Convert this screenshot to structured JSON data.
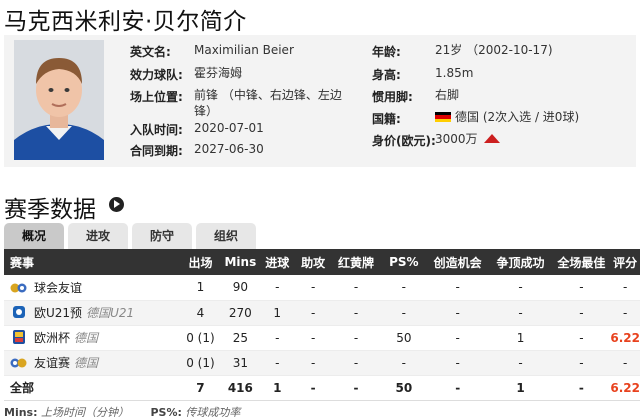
{
  "page": {
    "title": "马克西米利安·贝尔简介"
  },
  "profile": {
    "left": [
      {
        "label": "英文名:",
        "value": "Maximilian Beier"
      },
      {
        "label": "效力球队:",
        "value": "霍芬海姆"
      },
      {
        "label": "场上位置:",
        "value": "前锋 （中锋、右边锋、左边锋）"
      },
      {
        "label": "入队时间:",
        "value": "2020-07-01"
      },
      {
        "label": "合同到期:",
        "value": "2027-06-30"
      }
    ],
    "right": [
      {
        "label": "年龄:",
        "value": "21岁 （2002-10-17)"
      },
      {
        "label": "身高:",
        "value": "1.85m"
      },
      {
        "label": "惯用脚:",
        "value": "右脚"
      },
      {
        "label": "国籍:",
        "value": "德国 (2次入选 / 进0球)"
      },
      {
        "label": "身价(欧元):",
        "value": "3000万"
      }
    ],
    "nationality_flag": [
      "#000000",
      "#dd0000",
      "#ffce00"
    ],
    "value_trend": "up-arrow-icon",
    "trend_color": "#cc1f1f"
  },
  "stats": {
    "title": "赛季数据",
    "tabs": [
      "概况",
      "进攻",
      "防守",
      "组织"
    ],
    "active_tab": "概况",
    "columns": [
      "赛事",
      "出场",
      "Mins",
      "进球",
      "助攻",
      "红黄牌",
      "PS%",
      "创造机会",
      "争顶成功",
      "全场最佳",
      "评分"
    ],
    "rows": [
      {
        "icon": "friendly-club-icon",
        "name": "球会友谊",
        "sub": "",
        "apps": "1",
        "mins": "90",
        "goals": "-",
        "assists": "-",
        "cards": "-",
        "ps": "-",
        "chances": "-",
        "aerials": "-",
        "motm": "-",
        "rating": "-"
      },
      {
        "icon": "u21-euro-icon",
        "name": "欧U21预",
        "sub": "德国U21",
        "apps": "4",
        "mins": "270",
        "goals": "1",
        "assists": "-",
        "cards": "-",
        "ps": "-",
        "chances": "-",
        "aerials": "-",
        "motm": "-",
        "rating": "-"
      },
      {
        "icon": "euro-cup-icon",
        "name": "欧洲杯",
        "sub": "德国",
        "apps": "0 (1)",
        "mins": "25",
        "goals": "-",
        "assists": "-",
        "cards": "-",
        "ps": "50",
        "chances": "-",
        "aerials": "1",
        "motm": "-",
        "rating": "6.22"
      },
      {
        "icon": "friendly-intl-icon",
        "name": "友谊赛",
        "sub": "德国",
        "apps": "0 (1)",
        "mins": "31",
        "goals": "-",
        "assists": "-",
        "cards": "-",
        "ps": "-",
        "chances": "-",
        "aerials": "-",
        "motm": "-",
        "rating": "-"
      }
    ],
    "total": {
      "name": "全部",
      "apps": "7",
      "mins": "416",
      "goals": "1",
      "assists": "-",
      "cards": "-",
      "ps": "50",
      "chances": "-",
      "aerials": "1",
      "motm": "-",
      "rating": "6.22"
    },
    "rating_color": "#e8421e"
  },
  "footnotes": [
    {
      "key": "Mins:",
      "text": "上场时间（分钟）"
    },
    {
      "key": "PS%:",
      "text": "传球成功率"
    }
  ]
}
